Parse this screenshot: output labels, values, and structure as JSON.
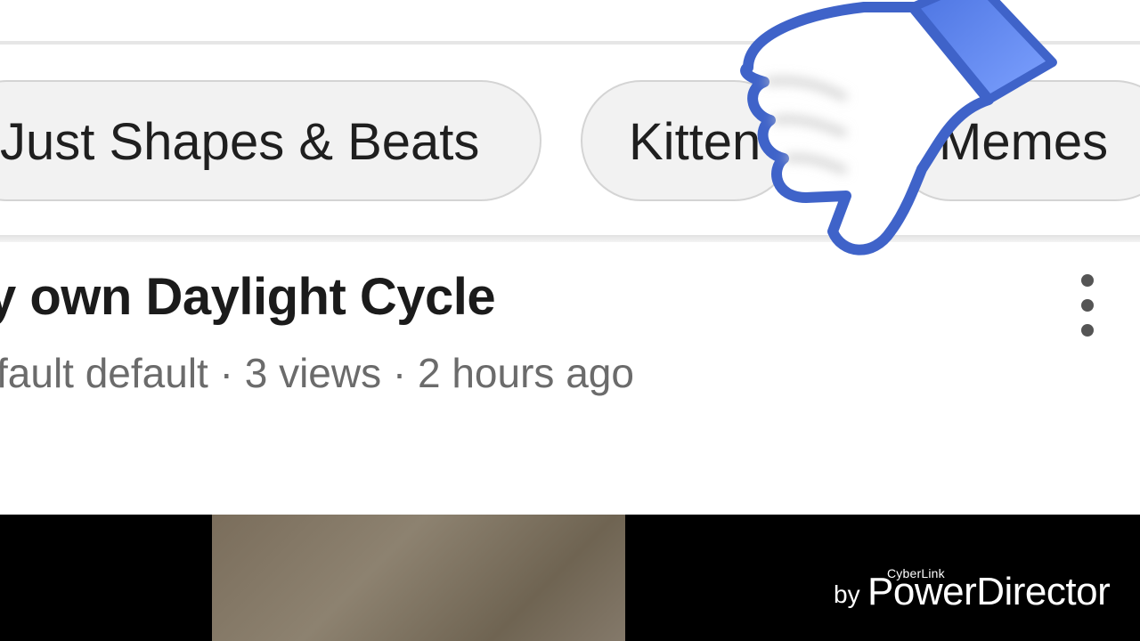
{
  "chips": [
    {
      "label": "Just Shapes & Beats"
    },
    {
      "label": "Kitten"
    },
    {
      "label": "Memes"
    }
  ],
  "video": {
    "title": "y own Daylight Cycle",
    "meta": "fault default · 3 views · 2 hours ago"
  },
  "menu": {
    "icon": "more-vert-icon"
  },
  "overlay": {
    "icon": "thumbs-down-icon",
    "color": "#3f63c9",
    "cuff_color": "#5b84ee"
  },
  "watermark": {
    "brand_small": "CyberLink",
    "by": "by",
    "product": "PowerDirector"
  },
  "colors": {
    "background": "#ffffff",
    "chip_background": "#f2f2f2",
    "title_text": "#1b1b1b",
    "meta_text": "#6b6b6b"
  }
}
